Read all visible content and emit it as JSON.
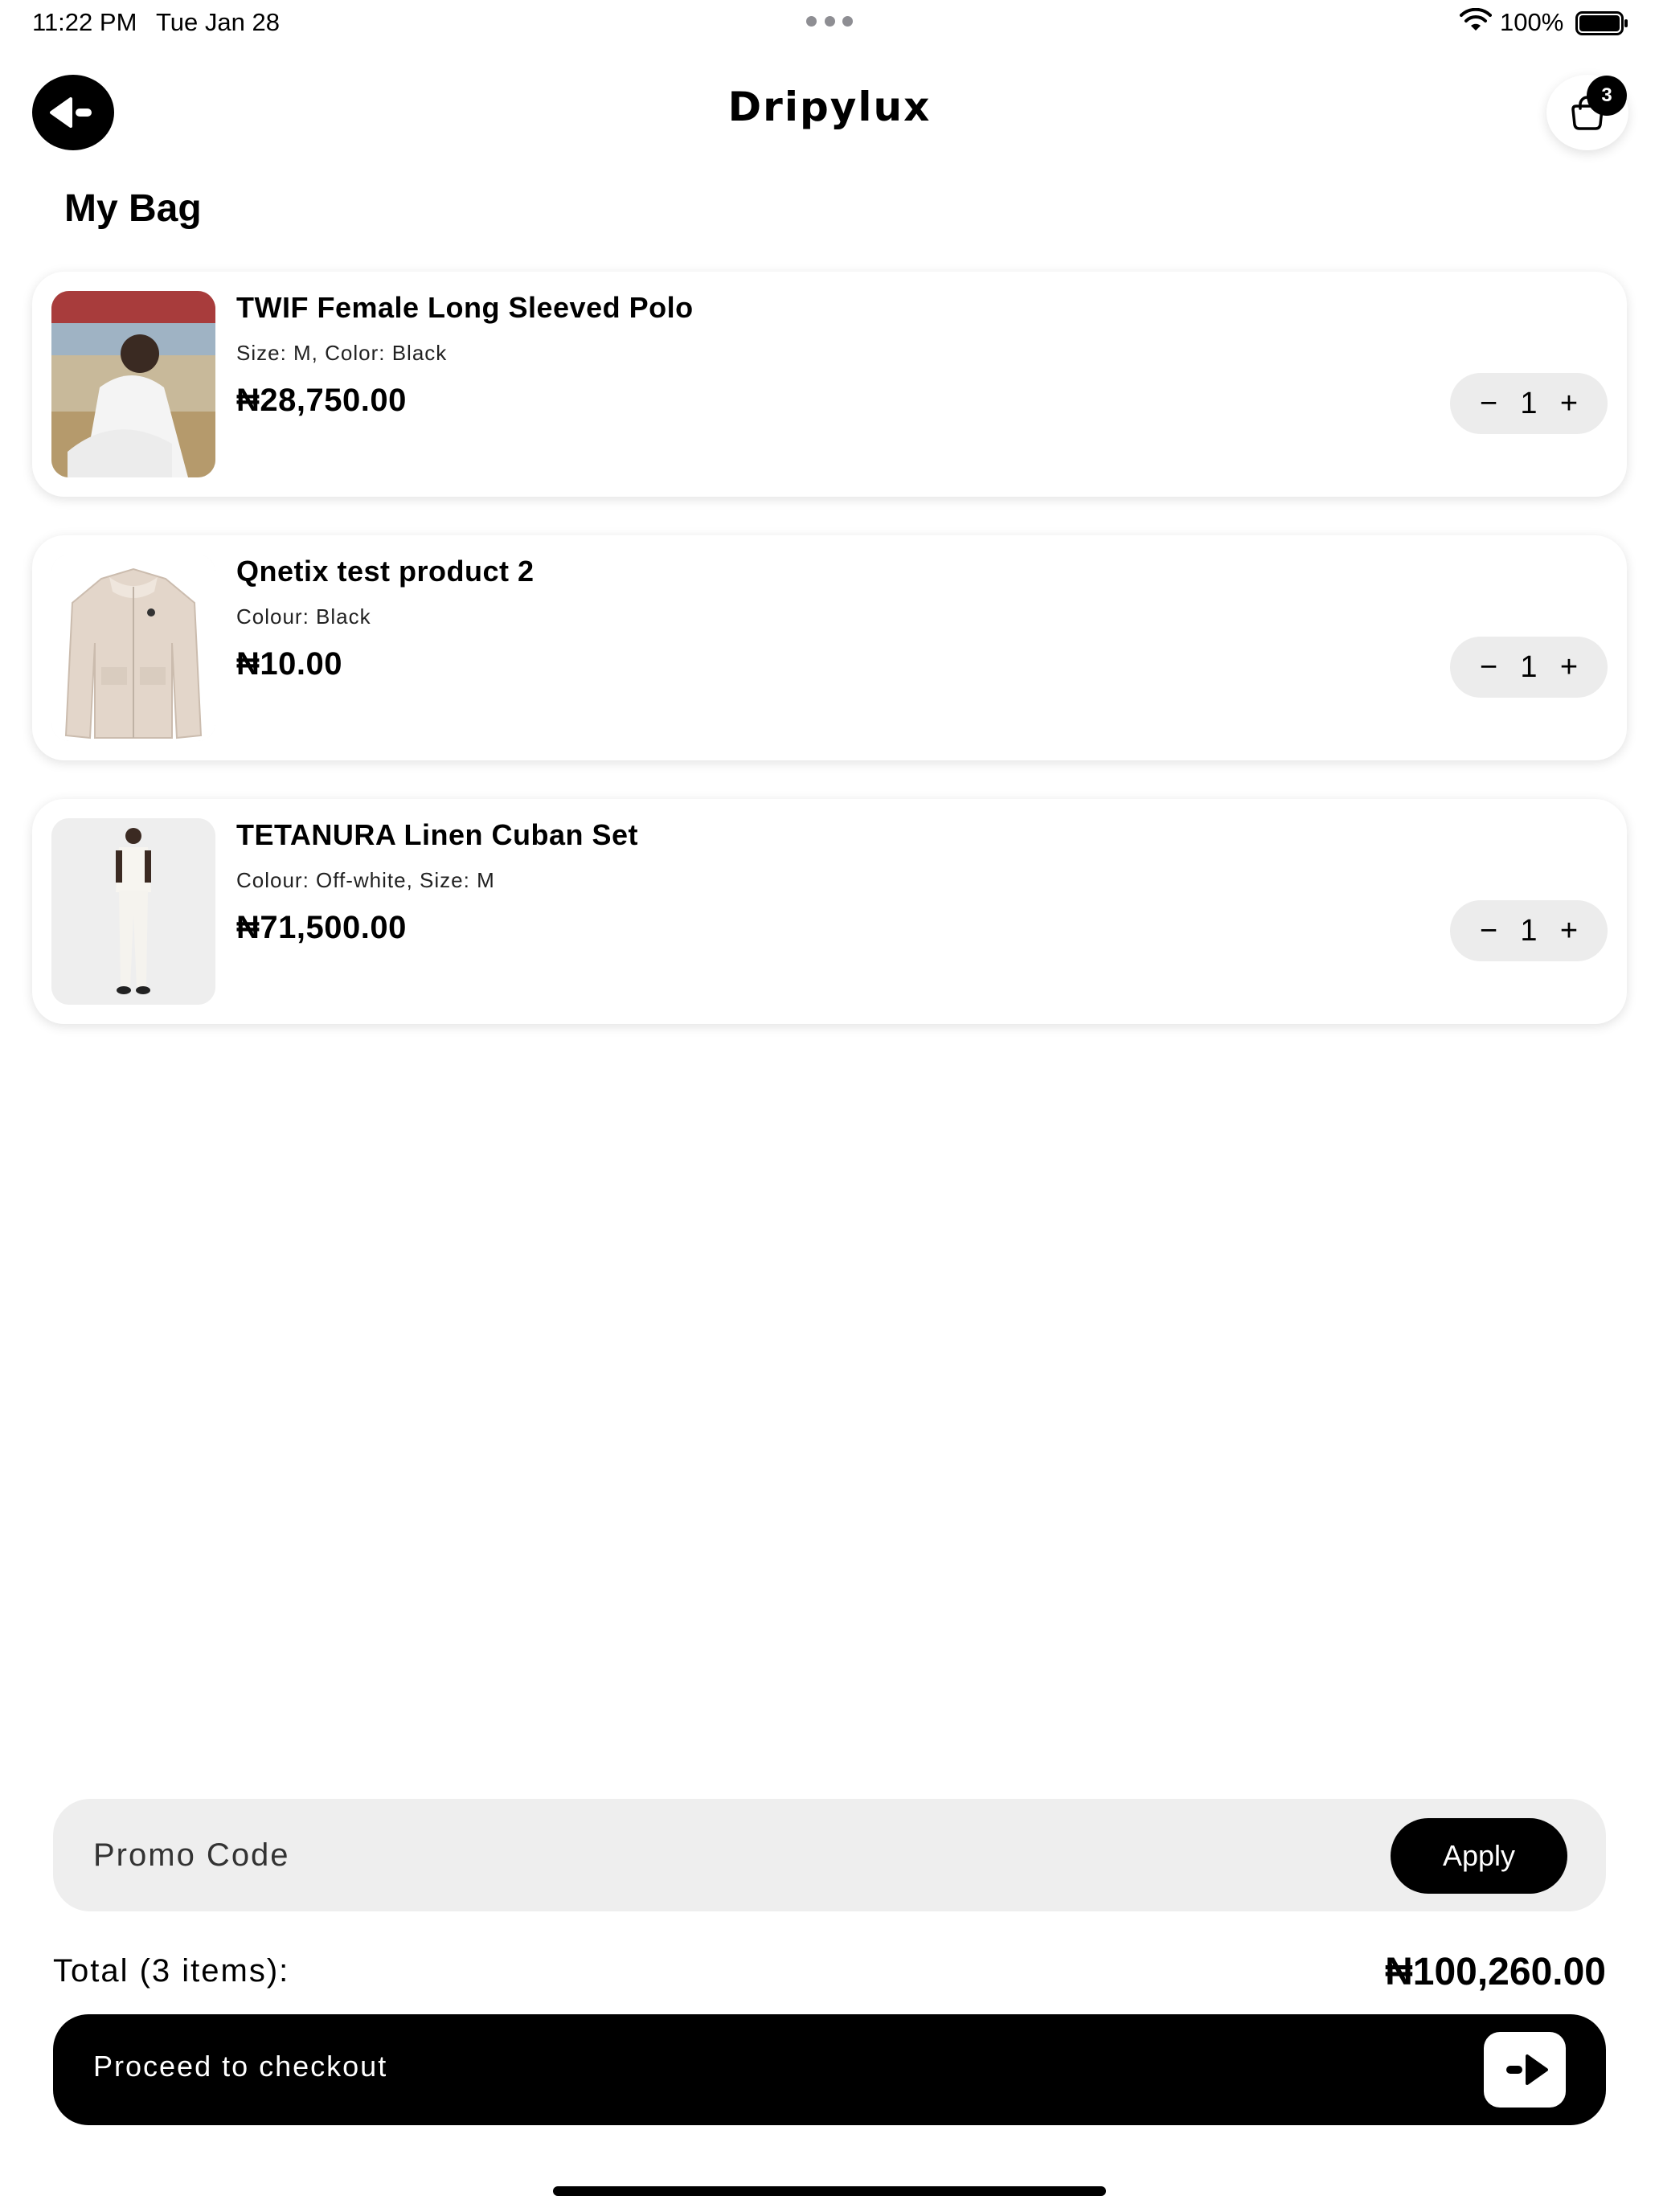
{
  "status_bar": {
    "time": "11:22 PM",
    "date": "Tue Jan 28",
    "battery": "100%"
  },
  "header": {
    "brand": "Dripylux",
    "cart_count": "3",
    "back_icon": "back-arrow-icon",
    "cart_icon": "shopping-bag-icon"
  },
  "page": {
    "title": "My Bag"
  },
  "items": [
    {
      "name": "TWIF Female Long Sleeved Polo",
      "variant": "Size: M, Color: Black",
      "price": "₦28,750.00",
      "quantity": "1"
    },
    {
      "name": "Qnetix test product 2",
      "variant": "Colour: Black",
      "price": "₦10.00",
      "quantity": "1"
    },
    {
      "name": "TETANURA Linen Cuban Set",
      "variant": "Colour: Off-white, Size: M",
      "price": "₦71,500.00",
      "quantity": "1"
    }
  ],
  "stepper": {
    "minus": "−",
    "plus": "+"
  },
  "promo": {
    "placeholder": "Promo Code",
    "apply_label": "Apply"
  },
  "summary": {
    "total_label": "Total (3 items):",
    "total_value": "₦100,260.00"
  },
  "checkout": {
    "label": "Proceed to checkout",
    "icon": "forward-arrow-icon"
  },
  "colors": {
    "background": "#ffffff",
    "primary": "#000000",
    "surface": "#eeeeee"
  }
}
